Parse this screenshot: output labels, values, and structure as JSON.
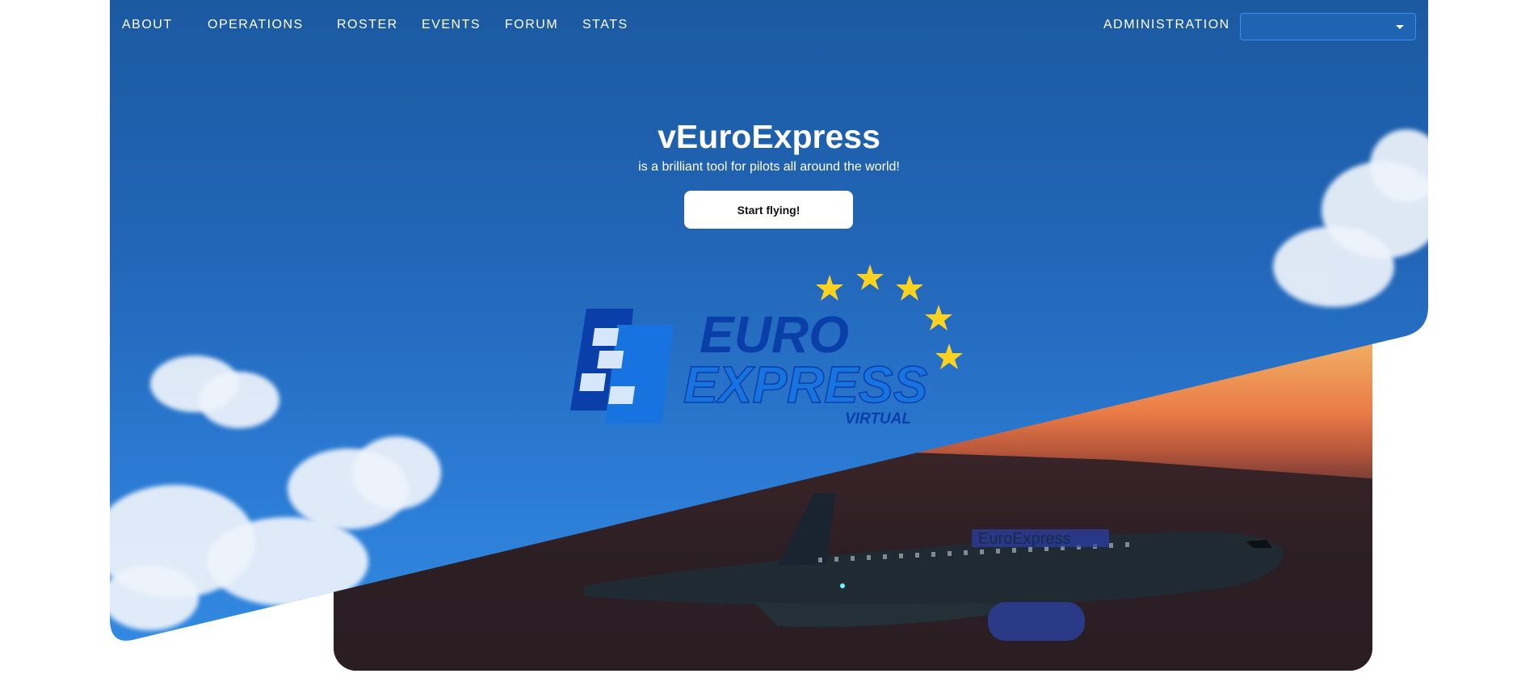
{
  "nav": {
    "items": [
      {
        "label": "ABOUT"
      },
      {
        "label": "OPERATIONS"
      },
      {
        "label": "ROSTER"
      },
      {
        "label": "EVENTS"
      },
      {
        "label": "FORUM"
      },
      {
        "label": "STATS"
      }
    ],
    "administration": {
      "label": "ADMINISTRATION"
    },
    "admin_select": {
      "value": ""
    }
  },
  "hero": {
    "title": "vEuroExpress",
    "subtitle": "is a brilliant tool for pilots all around the world!",
    "cta_label": "Start flying!"
  },
  "logo": {
    "line1": "EURO",
    "line2": "EXPRESS",
    "line3": "VIRTUAL",
    "colors": {
      "dark_blue": "#0a3ea8",
      "light_blue": "#1673e0",
      "star_yellow": "#ffd21f"
    }
  },
  "plane": {
    "livery_text": "EuroExpress"
  },
  "colors": {
    "sky_top": "#1b5aa1",
    "sky_bottom": "#3289e0",
    "sunset_orange": "#ea7c46",
    "button_bg": "#ffffff"
  }
}
